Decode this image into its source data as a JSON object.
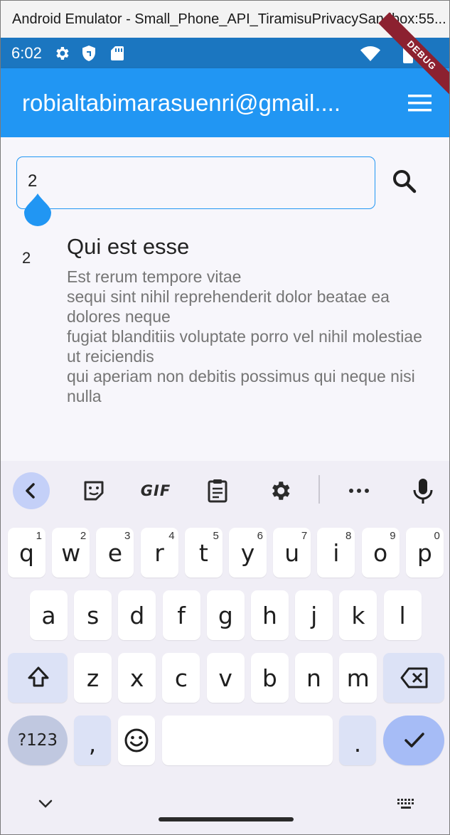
{
  "window": {
    "title": "Android Emulator - Small_Phone_API_TiramisuPrivacySandbox:55..."
  },
  "status_bar": {
    "time": "6:02",
    "left_icons": [
      "gear-icon",
      "shield-icon",
      "sd-card-icon"
    ],
    "right_icons": [
      "wifi-icon",
      "battery-icon"
    ],
    "debug_label": "DEBUG"
  },
  "app_bar": {
    "title": "robialtabimarasuenri@gmail....",
    "menu_icon": "hamburger-menu-icon",
    "color": "#2196f3"
  },
  "search": {
    "value": "2",
    "search_icon": "search-icon"
  },
  "post": {
    "id": "2",
    "title": "Qui est esse",
    "body": "Est rerum tempore vitae\nsequi sint nihil reprehenderit dolor beatae ea dolores neque\nfugiat blanditiis voluptate porro vel nihil molestiae ut reiciendis\nqui aperiam non debitis possimus qui neque nisi nulla"
  },
  "keyboard": {
    "toolbar": [
      "back-chevron-icon",
      "sticker-icon",
      "GIF",
      "clipboard-icon",
      "settings-gear-icon",
      "more-dots-icon",
      "microphone-icon"
    ],
    "row1": [
      {
        "key": "q",
        "hint": "1"
      },
      {
        "key": "w",
        "hint": "2"
      },
      {
        "key": "e",
        "hint": "3"
      },
      {
        "key": "r",
        "hint": "4"
      },
      {
        "key": "t",
        "hint": "5"
      },
      {
        "key": "y",
        "hint": "6"
      },
      {
        "key": "u",
        "hint": "7"
      },
      {
        "key": "i",
        "hint": "8"
      },
      {
        "key": "o",
        "hint": "9"
      },
      {
        "key": "p",
        "hint": "0"
      }
    ],
    "row2": [
      "a",
      "s",
      "d",
      "f",
      "g",
      "h",
      "j",
      "k",
      "l"
    ],
    "row3": [
      "z",
      "x",
      "c",
      "v",
      "b",
      "n",
      "m"
    ],
    "symbols_label": "?123",
    "comma": ",",
    "period": ".",
    "shift_icon": "shift-icon",
    "backspace_icon": "backspace-icon",
    "emoji_icon": "emoji-icon",
    "enter_icon": "checkmark-icon",
    "accent_color": "#a6bcf6"
  },
  "nav_bar": {
    "left_icon": "chevron-down-icon",
    "right_icon": "keyboard-switch-icon"
  }
}
